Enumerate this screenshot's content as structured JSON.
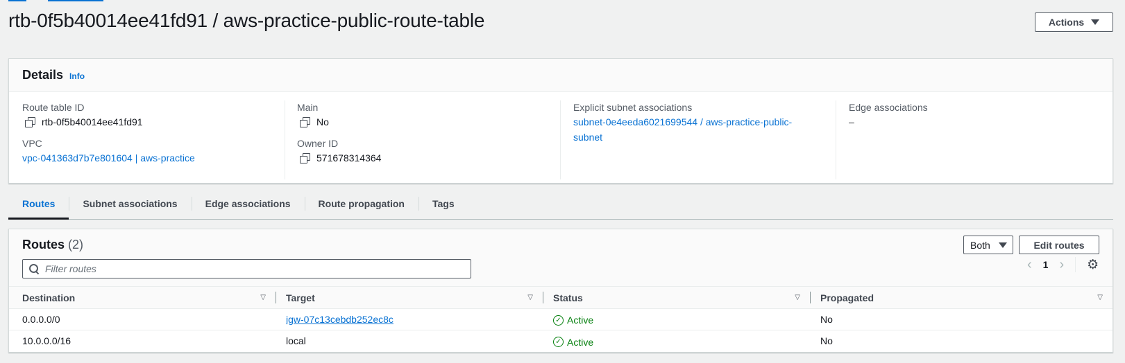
{
  "header": {
    "title": "rtb-0f5b40014ee41fd91 / aws-practice-public-route-table",
    "actions_label": "Actions"
  },
  "details": {
    "title": "Details",
    "info_label": "Info",
    "route_table_id_label": "Route table ID",
    "route_table_id": "rtb-0f5b40014ee41fd91",
    "vpc_label": "VPC",
    "vpc": "vpc-041363d7b7e801604 | aws-practice",
    "main_label": "Main",
    "main": "No",
    "owner_id_label": "Owner ID",
    "owner_id": "571678314364",
    "explicit_subnet_label": "Explicit subnet associations",
    "explicit_subnet": "subnet-0e4eeda6021699544 / aws-practice-public-subnet",
    "edge_associations_label": "Edge associations",
    "edge_associations": "–"
  },
  "tabs": [
    {
      "label": "Routes",
      "active": true
    },
    {
      "label": "Subnet associations",
      "active": false
    },
    {
      "label": "Edge associations",
      "active": false
    },
    {
      "label": "Route propagation",
      "active": false
    },
    {
      "label": "Tags",
      "active": false
    }
  ],
  "routes": {
    "title": "Routes",
    "count": "(2)",
    "filter_placeholder": "Filter routes",
    "filter_value": "",
    "select_value": "Both",
    "edit_label": "Edit routes",
    "page": "1",
    "columns": [
      "Destination",
      "Target",
      "Status",
      "Propagated"
    ],
    "rows": [
      {
        "destination": "0.0.0.0/0",
        "target": "igw-07c13cebdb252ec8c",
        "target_is_link": true,
        "status": "Active",
        "propagated": "No"
      },
      {
        "destination": "10.0.0.0/16",
        "target": "local",
        "target_is_link": false,
        "status": "Active",
        "propagated": "No"
      }
    ]
  },
  "colors": {
    "link": "#0972d3",
    "success": "#037f0c",
    "active_tab": "#0972d3"
  }
}
